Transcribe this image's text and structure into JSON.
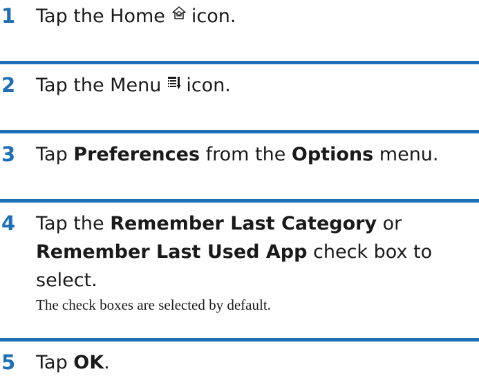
{
  "steps": [
    {
      "number": "1",
      "text_before": "Tap the Home",
      "icon": "home-icon",
      "text_after": "icon."
    },
    {
      "number": "2",
      "text_before": "Tap the Menu",
      "icon": "menu-icon",
      "text_after": "icon."
    },
    {
      "number": "3",
      "text_a": "Tap ",
      "bold_a": "Preferences",
      "text_b": " from the ",
      "bold_b": "Options",
      "text_c": " menu."
    },
    {
      "number": "4",
      "line1_text": "Tap the ",
      "line1_bold": "Remember Last Category",
      "line1_tail": " or",
      "line2_bold": "Remember Last Used App",
      "line2_tail": " check box to",
      "line3_text": "select.",
      "note": "The check boxes are selected by default."
    },
    {
      "number": "5",
      "text_a": "Tap ",
      "bold_a": "OK",
      "text_b": "."
    }
  ],
  "colors": {
    "accent": "#1f6fb6",
    "text": "#1a1a1a"
  }
}
